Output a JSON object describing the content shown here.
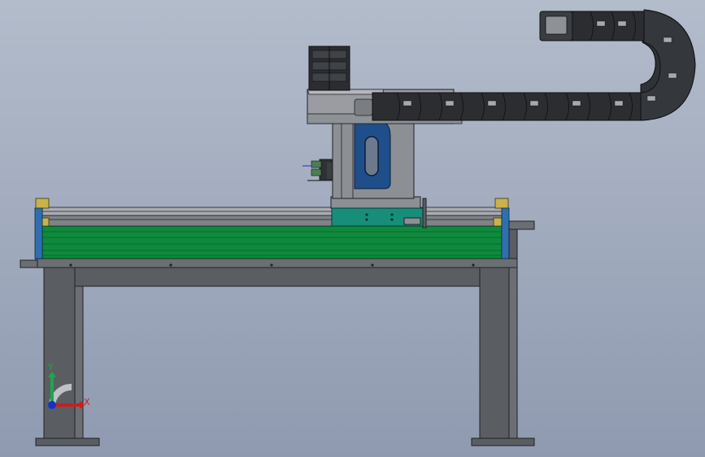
{
  "view": {
    "background_top": "#b3bccb",
    "background_bottom": "#8f9ab0"
  },
  "colors": {
    "frame_fill": "#5a5d62",
    "frame_fill_light": "#6b6e73",
    "frame_edge": "#1f2124",
    "rail_green": "#0e8a3c",
    "rail_green_dark": "#0a6b2e",
    "side_plate_blue": "#2f6fb0",
    "carriage_teal": "#168e7a",
    "column_grey": "#8c8f94",
    "column_panel_blue": "#1f4f8a",
    "beam_grey": "#9a9ca1",
    "chain_dark": "#2b2d31",
    "chain_mid": "#3c3f44",
    "bracket_yellow": "#c9b24a",
    "axis_x": "#d01b1b",
    "axis_y": "#1aa84a",
    "axis_z": "#1b2fd0"
  },
  "triad": {
    "x_label": "X",
    "y_label": "Y"
  },
  "icons": {
    "triad": "coordinate-triad-icon"
  }
}
